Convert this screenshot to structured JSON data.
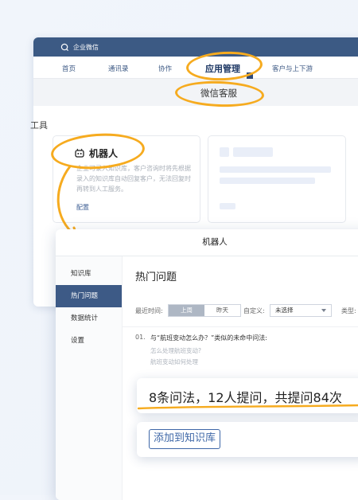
{
  "admin": {
    "app_name": "企业微信",
    "nav": [
      "首页",
      "通讯录",
      "协作",
      "应用管理",
      "客户与上下游"
    ],
    "sub_tab": "微信客服",
    "section_title": "工具",
    "robot_card": {
      "title": "机器人",
      "description": "企业可录入知识库，客户咨询时将先根据录入的知识库自动回复客户，无法回复时再转到人工服务。",
      "config_link": "配置"
    }
  },
  "robot_panel": {
    "title": "机器人",
    "sidebar": [
      "知识库",
      "热门问题",
      "数据统计",
      "设置"
    ],
    "active_sidebar": "热门问题",
    "page_title": "热门问题",
    "filters": {
      "recent_label": "最近时间:",
      "recent_options": [
        "上周",
        "昨天"
      ],
      "recent_selected": "上周",
      "custom_label": "自定义:",
      "custom_value": "未选择",
      "type_label": "类型:"
    },
    "question": {
      "number": "01.",
      "text": "与“航班变动怎么办？”类似的未命中问法:",
      "variants": [
        "怎么处理航班变动?",
        "航班变动如何处理"
      ]
    }
  },
  "callouts": {
    "stats": "8条问法，12人提问，共提问84次",
    "add_button": "添加到知识库"
  },
  "colors": {
    "accent": "#f6ab1f",
    "header": "#3c5a84",
    "link": "#3e67a7"
  }
}
